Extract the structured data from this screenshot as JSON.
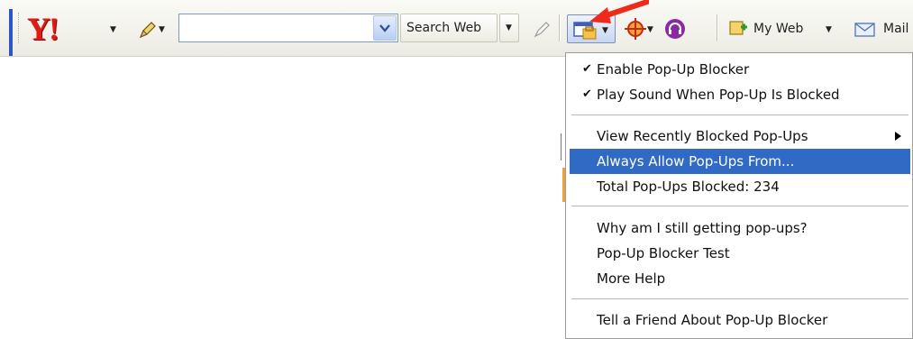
{
  "toolbar": {
    "logo_text": "Y!",
    "search_placeholder": "",
    "search_value": "",
    "search_web_label": "Search Web",
    "myweb_label": "My Web",
    "mail_label": "Mail"
  },
  "popup_menu": {
    "items": [
      {
        "label": "Enable Pop-Up Blocker",
        "checked": true
      },
      {
        "label": "Play Sound When Pop-Up Is Blocked",
        "checked": true
      },
      {
        "label": "View Recently Blocked Pop-Ups",
        "submenu": true
      },
      {
        "label": "Always Allow Pop-Ups From...",
        "highlighted": true
      },
      {
        "label": "Total Pop-Ups Blocked: 234"
      },
      {
        "label": "Why am I still getting pop-ups?"
      },
      {
        "label": "Pop-Up Blocker Test"
      },
      {
        "label": "More Help"
      },
      {
        "label": "Tell a Friend About Pop-Up Blocker"
      }
    ]
  },
  "colors": {
    "logo": "#e01b16",
    "highlight": "#316ac5",
    "annotation_arrow": "#ee2a1b"
  }
}
